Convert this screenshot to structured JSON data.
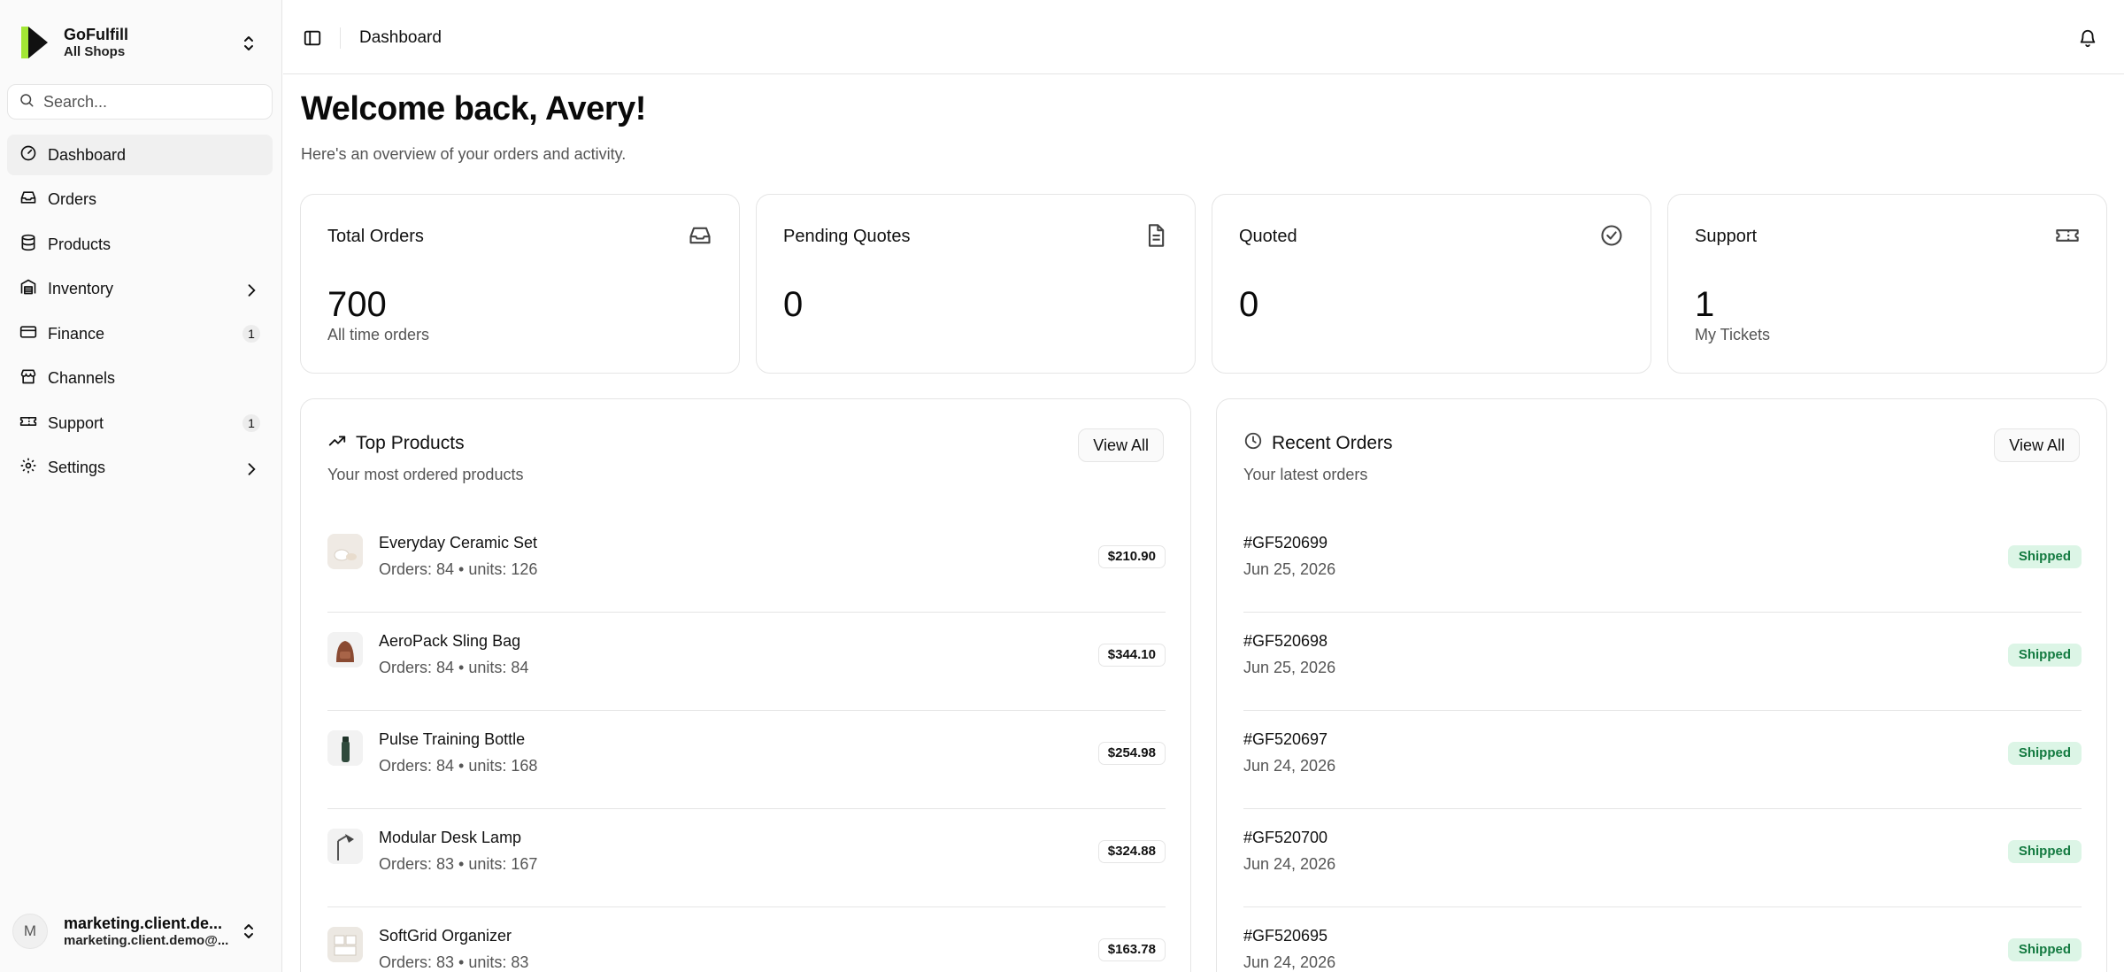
{
  "shop": {
    "name": "GoFulfill",
    "subtitle": "All Shops"
  },
  "search": {
    "placeholder": "Search..."
  },
  "sidebar": {
    "items": [
      {
        "label": "Dashboard",
        "icon": "gauge-icon",
        "active": true
      },
      {
        "label": "Orders",
        "icon": "inbox-icon"
      },
      {
        "label": "Products",
        "icon": "database-icon"
      },
      {
        "label": "Inventory",
        "icon": "warehouse-icon",
        "chevron": true
      },
      {
        "label": "Finance",
        "icon": "credit-card-icon",
        "badge": "1"
      },
      {
        "label": "Channels",
        "icon": "store-icon"
      },
      {
        "label": "Support",
        "icon": "ticket-icon",
        "badge": "1"
      },
      {
        "label": "Settings",
        "icon": "gear-icon",
        "chevron": true
      }
    ]
  },
  "user": {
    "initial": "M",
    "name": "marketing.client.de...",
    "email": "marketing.client.demo@..."
  },
  "header": {
    "breadcrumb": "Dashboard"
  },
  "welcome": {
    "title": "Welcome back, Avery!",
    "subtitle": "Here's an overview of your orders and activity."
  },
  "stats": [
    {
      "title": "Total Orders",
      "value": "700",
      "desc": "All time orders",
      "icon": "inbox-icon"
    },
    {
      "title": "Pending Quotes",
      "value": "0",
      "desc": "",
      "icon": "file-text-icon"
    },
    {
      "title": "Quoted",
      "value": "0",
      "desc": "",
      "icon": "check-circle-icon"
    },
    {
      "title": "Support",
      "value": "1",
      "desc": "My Tickets",
      "icon": "ticket-icon"
    }
  ],
  "top_products": {
    "title": "Top Products",
    "subtitle": "Your most ordered products",
    "view_all": "View All",
    "items": [
      {
        "name": "Everyday Ceramic Set",
        "meta": "Orders: 84 • units: 126",
        "price": "$210.90"
      },
      {
        "name": "AeroPack Sling Bag",
        "meta": "Orders: 84 • units: 84",
        "price": "$344.10"
      },
      {
        "name": "Pulse Training Bottle",
        "meta": "Orders: 84 • units: 168",
        "price": "$254.98"
      },
      {
        "name": "Modular Desk Lamp",
        "meta": "Orders: 83 • units: 167",
        "price": "$324.88"
      },
      {
        "name": "SoftGrid Organizer",
        "meta": "Orders: 83 • units: 83",
        "price": "$163.78"
      }
    ]
  },
  "recent_orders": {
    "title": "Recent Orders",
    "subtitle": "Your latest orders",
    "view_all": "View All",
    "items": [
      {
        "id": "#GF520699",
        "date": "Jun 25, 2026",
        "status": "Shipped"
      },
      {
        "id": "#GF520698",
        "date": "Jun 25, 2026",
        "status": "Shipped"
      },
      {
        "id": "#GF520697",
        "date": "Jun 24, 2026",
        "status": "Shipped"
      },
      {
        "id": "#GF520700",
        "date": "Jun 24, 2026",
        "status": "Shipped"
      },
      {
        "id": "#GF520695",
        "date": "Jun 24, 2026",
        "status": "Shipped"
      }
    ]
  },
  "colors": {
    "accent": "#a3e635",
    "border": "#e5e5e5",
    "success_bg": "#dcf5e6",
    "success_text": "#137a40"
  }
}
